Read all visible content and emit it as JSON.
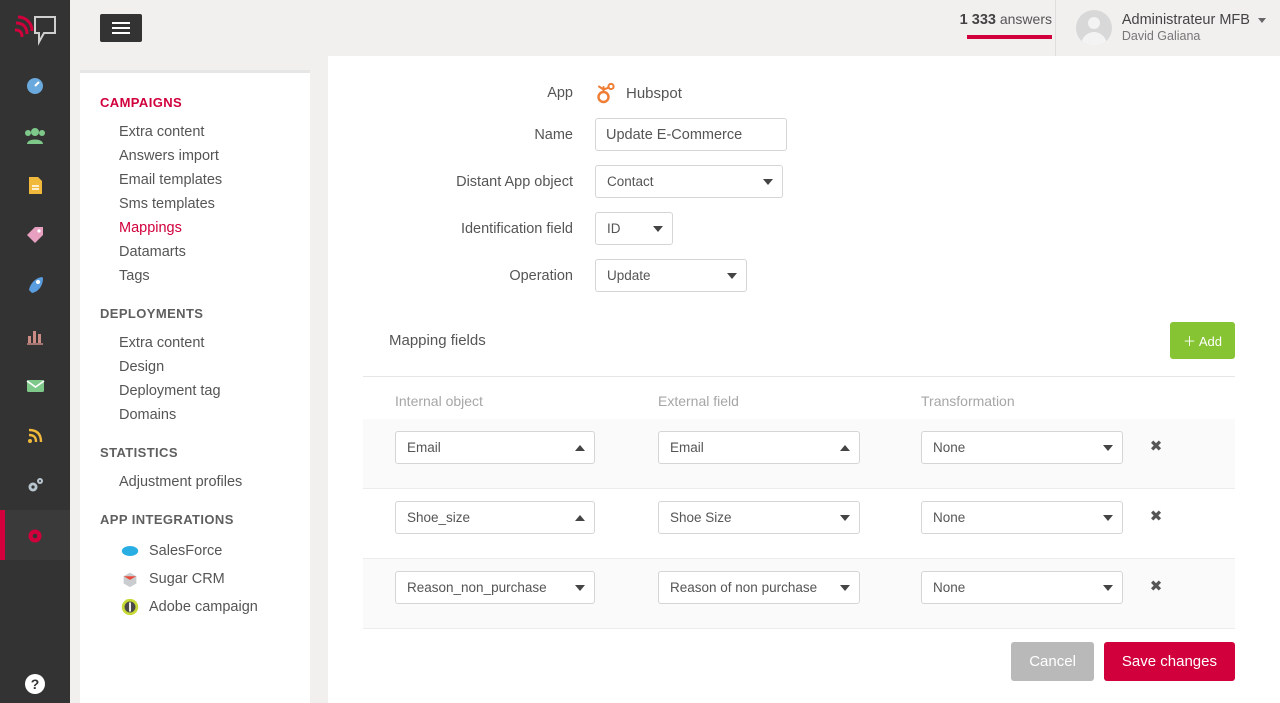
{
  "brand": {
    "accent": "#d1003c",
    "green": "#86c434",
    "rail_bg": "#333333",
    "page_bg": "#f1f0ef",
    "logo_icon": "speech-bubble-signal-logo"
  },
  "topbar": {
    "menu_toggle_icon": "hamburger-icon",
    "answers_count": "1 333",
    "answers_label": "answers",
    "user": {
      "avatar_icon": "user-avatar-icon",
      "name": "Administrateur MFB",
      "subtitle": "David Galiana",
      "caret_icon": "chevron-down-icon"
    }
  },
  "rail": {
    "items": [
      {
        "name": "dashboard",
        "icon": "speedometer-icon"
      },
      {
        "name": "contacts",
        "icon": "people-group-icon"
      },
      {
        "name": "documents",
        "icon": "document-icon"
      },
      {
        "name": "tags",
        "icon": "tags-icon"
      },
      {
        "name": "campaigns",
        "icon": "rocket-icon"
      },
      {
        "name": "statistics",
        "icon": "bar-chart-icon"
      },
      {
        "name": "email",
        "icon": "envelope-icon"
      },
      {
        "name": "feed",
        "icon": "rss-icon"
      },
      {
        "name": "settings",
        "icon": "gears-icon"
      },
      {
        "name": "admin",
        "icon": "gear-icon",
        "active": true
      }
    ],
    "help_icon": "question-mark-icon"
  },
  "nav": {
    "groups": [
      {
        "title": "CAMPAIGNS",
        "accent": true,
        "items": [
          {
            "label": "Extra content"
          },
          {
            "label": "Answers import"
          },
          {
            "label": "Email templates"
          },
          {
            "label": "Sms templates"
          },
          {
            "label": "Mappings",
            "active": true
          },
          {
            "label": "Datamarts"
          },
          {
            "label": "Tags"
          }
        ]
      },
      {
        "title": "DEPLOYMENTS",
        "accent": false,
        "items": [
          {
            "label": "Extra content"
          },
          {
            "label": "Design"
          },
          {
            "label": "Deployment tag"
          },
          {
            "label": "Domains"
          }
        ]
      },
      {
        "title": "STATISTICS",
        "accent": false,
        "items": [
          {
            "label": "Adjustment profiles"
          }
        ]
      },
      {
        "title": "APP INTEGRATIONS",
        "accent": false,
        "items": [
          {
            "label": "SalesForce",
            "icon": "salesforce-cloud-icon"
          },
          {
            "label": "Sugar CRM",
            "icon": "sugarcrm-cube-icon"
          },
          {
            "label": "Adobe campaign",
            "icon": "adobe-campaign-icon"
          }
        ]
      }
    ]
  },
  "form": {
    "app": {
      "label": "App",
      "value": "Hubspot",
      "icon": "hubspot-sprocket-icon"
    },
    "name": {
      "label": "Name",
      "value": "Update E-Commerce",
      "placeholder": "Name"
    },
    "distant_app_object": {
      "label": "Distant App object",
      "value": "Contact",
      "arrow": "down"
    },
    "identification_field": {
      "label": "Identification field",
      "value": "ID",
      "arrow": "down"
    },
    "operation": {
      "label": "Operation",
      "value": "Update",
      "arrow": "down"
    }
  },
  "mapping": {
    "title": "Mapping fields",
    "add_label": "＋ Add",
    "columns": [
      "Internal object",
      "External field",
      "Transformation"
    ],
    "remove_icon": "close-x-icon",
    "rows": [
      {
        "internal": {
          "value": "Email",
          "arrow": "up"
        },
        "external": {
          "value": "Email",
          "arrow": "up"
        },
        "transformation": {
          "value": "None",
          "arrow": "down"
        }
      },
      {
        "internal": {
          "value": "Shoe_size",
          "arrow": "up"
        },
        "external": {
          "value": "Shoe Size",
          "arrow": "down"
        },
        "transformation": {
          "value": "None",
          "arrow": "down"
        }
      },
      {
        "internal": {
          "value": "Reason_non_purchase",
          "arrow": "down"
        },
        "external": {
          "value": "Reason of non purchase",
          "arrow": "down"
        },
        "transformation": {
          "value": "None",
          "arrow": "down"
        }
      }
    ]
  },
  "actions": {
    "cancel_label": "Cancel",
    "save_label": "Save changes"
  }
}
